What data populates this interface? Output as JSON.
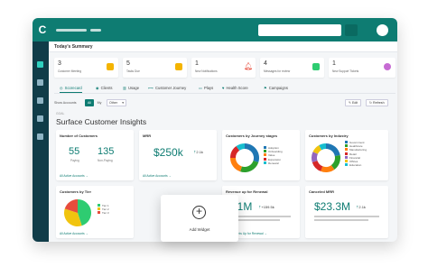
{
  "app": {
    "logo": "C"
  },
  "summary": {
    "title": "Today's Summary"
  },
  "kpis": [
    {
      "value": "3",
      "label": "Customer Meeting",
      "color": "#f4b400"
    },
    {
      "value": "5",
      "label": "Tasks Due",
      "color": "#f4b400"
    },
    {
      "value": "1",
      "label": "New Notifications",
      "color": "#e74c3c"
    },
    {
      "value": "4",
      "label": "Messages for review",
      "color": "#2ecc71"
    },
    {
      "value": "1",
      "label": "New Support Tickets",
      "color": "#c66bd3"
    }
  ],
  "tabs": [
    {
      "label": "Scorecard",
      "icon": "◎"
    },
    {
      "label": "Clients",
      "icon": "◉"
    },
    {
      "label": "Usage",
      "icon": "▥"
    },
    {
      "label": "Customer Journey",
      "icon": "⟷"
    },
    {
      "label": "Plays",
      "icon": "▭"
    },
    {
      "label": "Health Score",
      "icon": "♥"
    },
    {
      "label": "Campaigns",
      "icon": "⚑"
    }
  ],
  "filters": {
    "label": "Show Accounts",
    "all": "All",
    "my": "My",
    "other": "Other",
    "edit": "Edit",
    "refresh": "Refresh"
  },
  "goal": "GOAL",
  "heading": "Surface Customer Insights",
  "cards": {
    "customers": {
      "title": "Number of Customers",
      "paying": "55",
      "paying_label": "Paying",
      "nonpaying": "135",
      "nonpaying_label": "Non-Paying",
      "footer": "All Active Accounts"
    },
    "mrr": {
      "title": "MRR",
      "value": "$250k",
      "trend": "2.1k",
      "footer": "All Active Accounts"
    },
    "journey": {
      "title": "Customers by Journey stages",
      "legend": [
        "Adoption",
        "Onboarding",
        "Value",
        "Expansion",
        "Renewal"
      ],
      "values": [
        30,
        25,
        20,
        15,
        10
      ],
      "colors": [
        "#1f77b4",
        "#2ca02c",
        "#ff7f0e",
        "#d62728",
        "#17becf"
      ]
    },
    "industry": {
      "title": "Customers by Industry",
      "legend": [
        "Government",
        "Healthcare",
        "Manufacturing",
        "Retail",
        "Financial",
        "Offices",
        "Education"
      ],
      "values": [
        22,
        18,
        16,
        14,
        12,
        10,
        8
      ],
      "colors": [
        "#1f77b4",
        "#2ca02c",
        "#ff7f0e",
        "#d62728",
        "#9467bd",
        "#f1c40f",
        "#17becf"
      ]
    },
    "tier": {
      "title": "Customers by Tier",
      "legend": [
        "Tier 1",
        "Tier 2",
        "Tier 3"
      ],
      "values": [
        45,
        35,
        20
      ],
      "colors": [
        "#2ecc71",
        "#f1c40f",
        "#e74c3c"
      ],
      "footer": "All Active Accounts"
    },
    "renewal": {
      "title": "Revenue up for Renewal",
      "value": "$1M",
      "trend": "+159.5k",
      "footer": "All Accounts Up for Renewal"
    },
    "cancelled": {
      "title": "Canceled MRR",
      "value": "$23.3M",
      "trend": "2.1k"
    }
  },
  "add_widget": {
    "label": "Add Widget"
  }
}
